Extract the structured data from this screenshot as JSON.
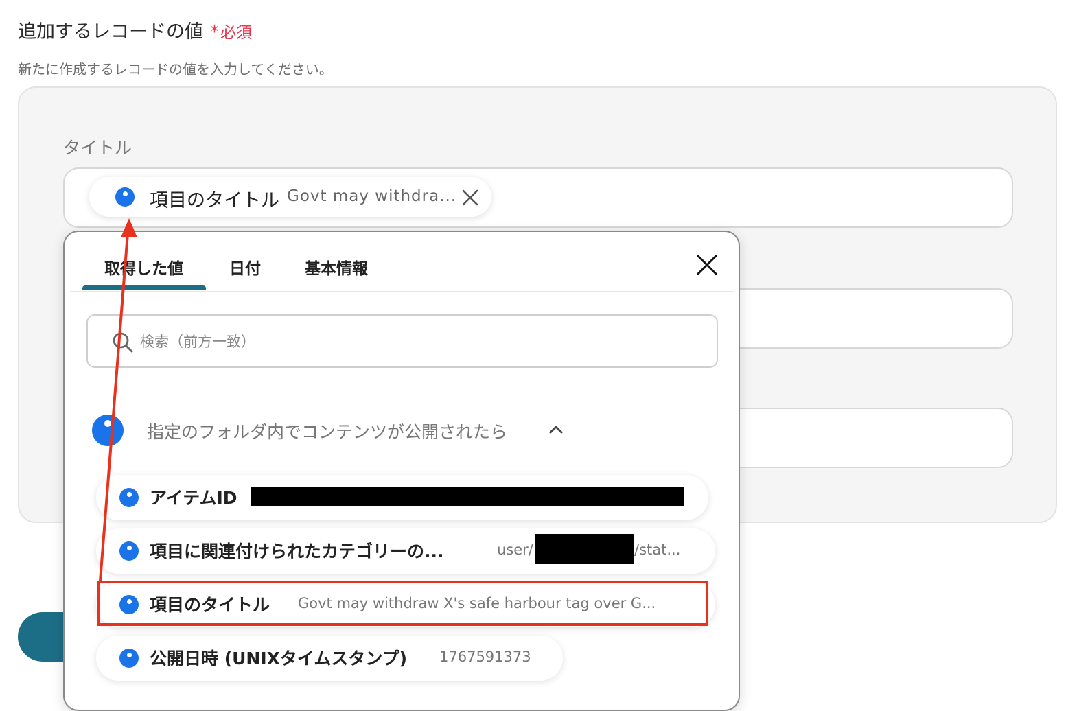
{
  "section": {
    "title": "追加するレコードの値",
    "required_mark": "*",
    "required_text": "必須",
    "description": "新たに作成するレコードの値を入力してください。"
  },
  "field": {
    "label": "タイトル",
    "token": {
      "label": "項目のタイトル",
      "value": "Govt may withdra..."
    }
  },
  "popup": {
    "tabs": [
      {
        "label": "取得した値",
        "active": true
      },
      {
        "label": "日付",
        "active": false
      },
      {
        "label": "基本情報",
        "active": false
      }
    ],
    "search_placeholder": "検索（前方一致）",
    "group": {
      "label": "指定のフォルダ内でコンテンツが公開されたら",
      "expanded": true
    },
    "items": [
      {
        "label": "アイテムID",
        "value": ""
      },
      {
        "label": "項目に関連付けられたカテゴリーの...",
        "value_prefix": "user/",
        "value_suffix": "/stat..."
      },
      {
        "label": "項目のタイトル",
        "value": "Govt may withdraw X's safe harbour tag over G..."
      },
      {
        "label": "公開日時 (UNIXタイムスタンプ)",
        "value": "1767591373"
      }
    ]
  },
  "colors": {
    "accent": "#1c6e87",
    "required": "#e8364f",
    "dot": "#1a73e8",
    "highlight": "#e8321e"
  }
}
